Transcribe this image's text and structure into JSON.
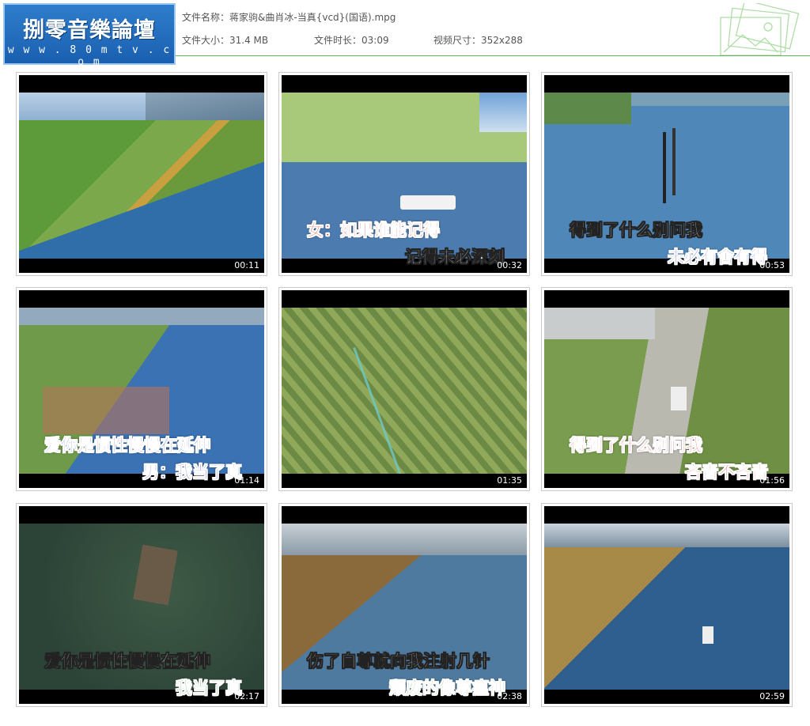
{
  "logo": {
    "title": "捌零音樂論壇",
    "url": "w w w . 8 0 m t v . c o m"
  },
  "file": {
    "name_label": "文件名称：",
    "name_value": "蒋家驹&曲肖冰-当真{vcd}(国语).mpg",
    "size_label": "文件大小：",
    "size_value": "31.4 MB",
    "duration_label": "文件时长：",
    "duration_value": "03:09",
    "dims_label": "视频尺寸：",
    "dims_value": "352x288"
  },
  "thumbnails": [
    {
      "time": "00:11",
      "line1": "",
      "line2": ""
    },
    {
      "time": "00:32",
      "line1": "女：如果谁能记得",
      "line2": "记得未必深刻"
    },
    {
      "time": "00:53",
      "line1": "得到了什么别问我",
      "line2": "未必有舍有得"
    },
    {
      "time": "01:14",
      "line1": "爱你是惯性慢慢在延伸",
      "line2": "男：我当了真"
    },
    {
      "time": "01:35",
      "line1": "",
      "line2": ""
    },
    {
      "time": "01:56",
      "line1": "得到了什么别问我",
      "line2": "吝啬不吝啬"
    },
    {
      "time": "02:17",
      "line1": "爱你是惯性慢慢在延伸",
      "line2": "我当了真"
    },
    {
      "time": "02:38",
      "line1": "伤了自尊就向我注射几针",
      "line2": "颓废的像尊瘟神"
    },
    {
      "time": "02:59",
      "line1": "",
      "line2": ""
    }
  ],
  "colors": {
    "accent_green": "#5cb85c",
    "logo_blue": "#1a5fb0"
  }
}
